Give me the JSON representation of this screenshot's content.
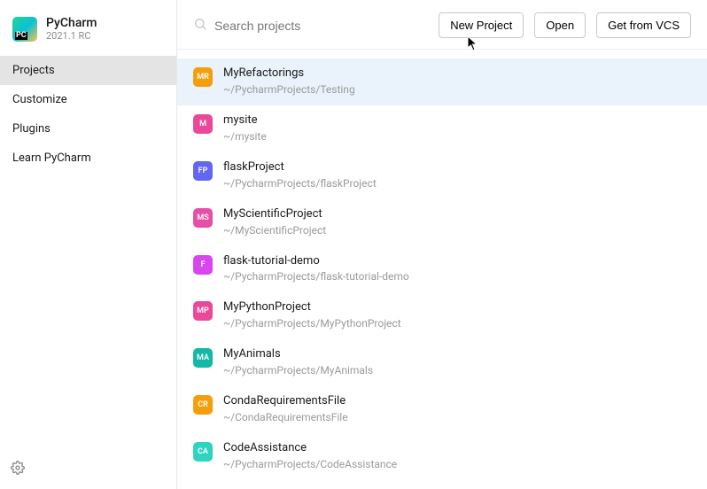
{
  "app": {
    "name": "PyCharm",
    "version": "2021.1 RC"
  },
  "sidebar": {
    "items": [
      {
        "label": "Projects",
        "selected": true
      },
      {
        "label": "Customize",
        "selected": false
      },
      {
        "label": "Plugins",
        "selected": false
      },
      {
        "label": "Learn PyCharm",
        "selected": false
      }
    ]
  },
  "search": {
    "placeholder": "Search projects"
  },
  "actions": {
    "new": "New Project",
    "open": "Open",
    "vcs": "Get from VCS"
  },
  "projects": [
    {
      "initials": "MR",
      "name": "MyRefactorings",
      "path": "~/PycharmProjects/Testing",
      "color": "#f59e0b",
      "selected": true
    },
    {
      "initials": "M",
      "name": "mysite",
      "path": "~/mysite",
      "color": "#ec4899",
      "selected": false
    },
    {
      "initials": "FP",
      "name": "flaskProject",
      "path": "~/PycharmProjects/flaskProject",
      "color": "#6366f1",
      "selected": false
    },
    {
      "initials": "MS",
      "name": "MyScientificProject",
      "path": "~/MyScientificProject",
      "color": "#e64fa7",
      "selected": false
    },
    {
      "initials": "F",
      "name": "flask-tutorial-demo",
      "path": "~/PycharmProjects/flask-tutorial-demo",
      "color": "#d946ef",
      "selected": false
    },
    {
      "initials": "MP",
      "name": "MyPythonProject",
      "path": "~/PycharmProjects/MyPythonProject",
      "color": "#ec4899",
      "selected": false
    },
    {
      "initials": "MA",
      "name": "MyAnimals",
      "path": "~/PycharmProjects/MyAnimals",
      "color": "#14b8a6",
      "selected": false
    },
    {
      "initials": "CR",
      "name": "CondaRequirementsFile",
      "path": "~/CondaRequirementsFile",
      "color": "#f59e0b",
      "selected": false
    },
    {
      "initials": "CA",
      "name": "CodeAssistance",
      "path": "~/PycharmProjects/CodeAssistance",
      "color": "#2dd4bf",
      "selected": false
    }
  ]
}
